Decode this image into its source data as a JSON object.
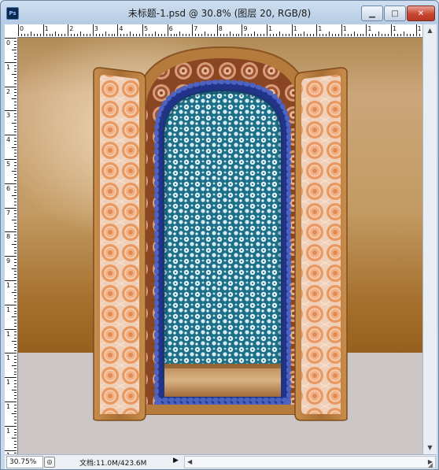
{
  "window": {
    "title": "未标题-1.psd @ 30.8% (图层 20, RGB/8)",
    "app_icon": "Ps",
    "controls": {
      "minimize": "▁",
      "maximize": "□",
      "close": "✕"
    }
  },
  "rulers": {
    "horizontal": [
      "0",
      "1",
      "2",
      "3",
      "4",
      "5",
      "6",
      "7",
      "8",
      "9",
      "1",
      "1",
      "1",
      "1",
      "1",
      "1",
      "1"
    ],
    "vertical": [
      "0",
      "1",
      "2",
      "3",
      "4",
      "5",
      "6",
      "7",
      "8",
      "9",
      "1",
      "1",
      "1",
      "1",
      "1",
      "1",
      "1",
      "1"
    ]
  },
  "statusbar": {
    "zoom": "30.75%",
    "doc_info": "文档:11.0M/423.6M",
    "menu_arrow": "▶",
    "scroll_left": "◀",
    "scroll_right": "▶"
  },
  "scrollbars": {
    "up": "▲",
    "down": "▼"
  },
  "icons": {
    "app": "photoshop-icon",
    "minimize": "minimize-icon",
    "maximize": "maximize-icon",
    "close": "close-icon",
    "zoom_menu": "zoom-menu-icon"
  },
  "colors": {
    "wall": "#c39a63",
    "floor": "#ccc6c6",
    "door_frame": "#b57b3c",
    "door_panel": "#e7a57a",
    "niche_pattern": "#1d7590",
    "bead_border": "#22338a",
    "arch_band": "#8a4623"
  }
}
